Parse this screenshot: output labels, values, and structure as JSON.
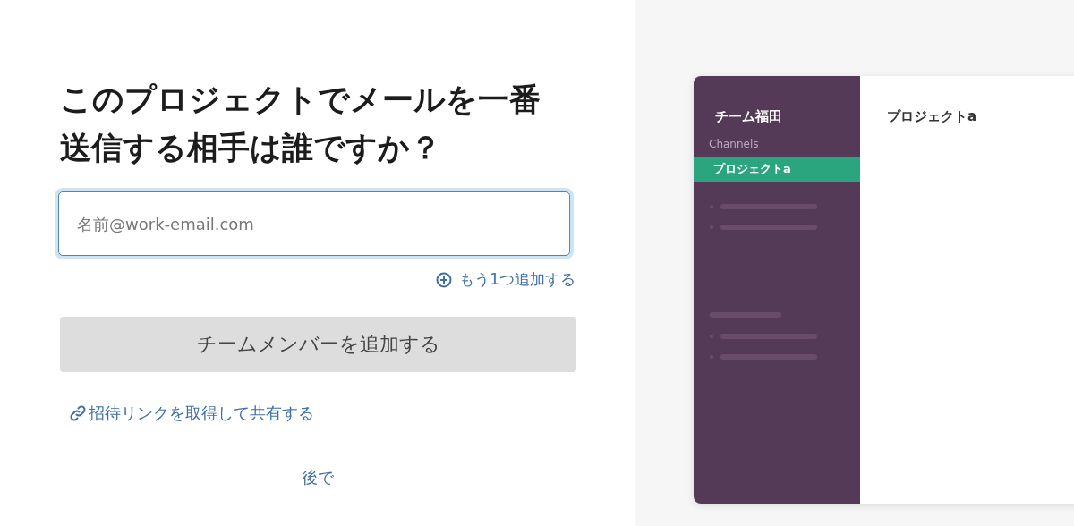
{
  "invite": {
    "heading": "このプロジェクトでメールを一番送信する相手は誰ですか？",
    "email_field": {
      "placeholder": "名前@work-email.com",
      "focused": true
    },
    "add_another": "もう1つ追加する",
    "submit_button": {
      "label": "チームメンバーを追加する",
      "disabled": true
    },
    "invite_link": "招待リンクを取得して共有する",
    "later": "後で"
  },
  "preview": {
    "team_name": "チーム福田",
    "section_label": "Channels",
    "channels": [
      {
        "label": "プロジェクトa",
        "selected": true
      }
    ],
    "header": "プロジェクトa"
  }
}
